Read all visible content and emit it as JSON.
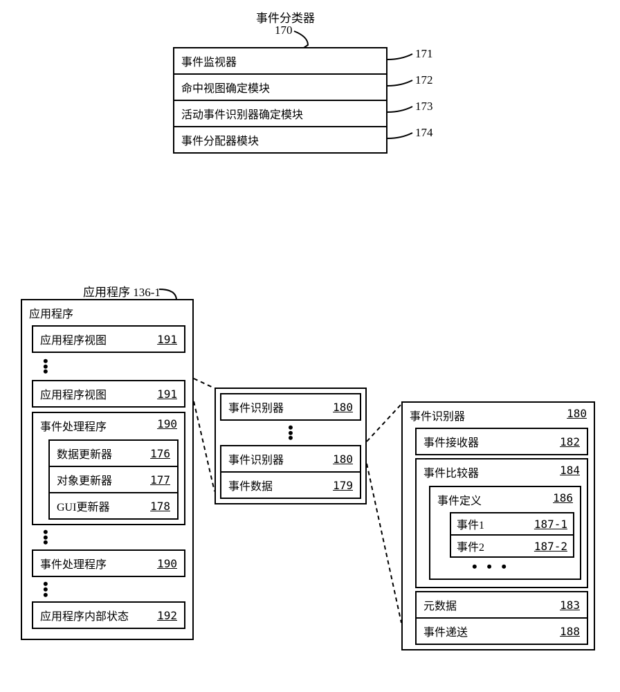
{
  "classifier": {
    "title": "事件分类器",
    "ref": "170",
    "rows": [
      {
        "label": "事件监视器",
        "ref": "171"
      },
      {
        "label": "命中视图确定模块",
        "ref": "172"
      },
      {
        "label": "活动事件识别器确定模块",
        "ref": "173"
      },
      {
        "label": "事件分配器模块",
        "ref": "174"
      }
    ]
  },
  "app": {
    "title": "应用程序",
    "ref": "136-1",
    "header": "应用程序",
    "view_label": "应用程序视图",
    "view_ref": "191",
    "handler_label": "事件处理程序",
    "handler_ref": "190",
    "data_updater": "数据更新器",
    "data_updater_ref": "176",
    "obj_updater": "对象更新器",
    "obj_updater_ref": "177",
    "gui_updater": "GUI更新器",
    "gui_updater_ref": "178",
    "internal_state": "应用程序内部状态",
    "internal_state_ref": "192"
  },
  "middle": {
    "recognizer": "事件识别器",
    "recognizer_ref": "180",
    "event_data": "事件数据",
    "event_data_ref": "179"
  },
  "right": {
    "recognizer": "事件识别器",
    "recognizer_ref": "180",
    "receiver": "事件接收器",
    "receiver_ref": "182",
    "comparator": "事件比较器",
    "comparator_ref": "184",
    "definition": "事件定义",
    "definition_ref": "186",
    "event1": "事件1",
    "event1_ref": "187-1",
    "event2": "事件2",
    "event2_ref": "187-2",
    "metadata": "元数据",
    "metadata_ref": "183",
    "delivery": "事件递送",
    "delivery_ref": "188"
  }
}
